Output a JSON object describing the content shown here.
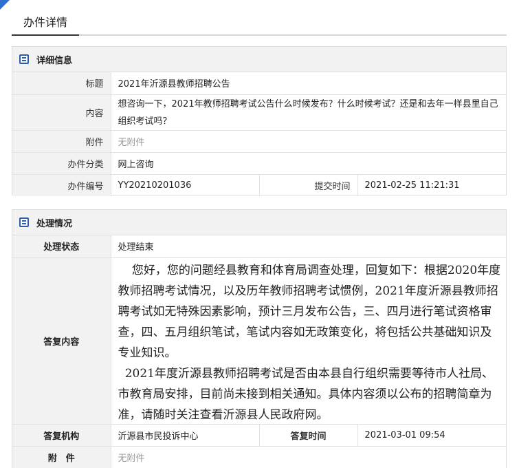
{
  "page": {
    "title": "办件详情"
  },
  "details": {
    "section_title": "详细信息",
    "title_label": "标题",
    "title_value": "2021年沂源县教师招聘公告",
    "content_label": "内容",
    "content_value": "想咨询一下，2021年教师招聘考试公告什么时候发布？什么时候考试？还是和去年一样县里自己组织考试吗？",
    "attachment_label": "附件",
    "attachment_value": "无附件",
    "category_label": "办件分类",
    "category_value": "网上咨询",
    "number_label": "办件编号",
    "number_value": "YY20210201036",
    "submit_time_label": "提交时间",
    "submit_time_value": "2021-02-25 11:21:31"
  },
  "handling": {
    "section_title": "处理情况",
    "status_label": "处理状态",
    "status_value": "处理结束",
    "reply_label": "答复内容",
    "reply_para_1": "您好，您的问题经县教育和体育局调查处理，回复如下：根据2020年度教师招聘考试情况，以及历年教师招聘考试惯例，2021年度沂源县教师招聘考试如无特殊因素影响，预计三月发布公告，三、四月进行笔试资格审查，四、五月组织笔试，笔试内容如无政策变化，将包括公共基础知识及专业知识。",
    "reply_para_2": "2021年度沂源县教师招聘考试是否由本县自行组织需要等待市人社局、市教育局安排，目前尚未接到相关通知。具体内容须以公布的招聘简章为准，请随时关注查看沂源县人民政府网。",
    "org_label": "答复机构",
    "org_value": "沂源县市民投诉中心",
    "reply_time_label": "答复时间",
    "reply_time_value": "2021-03-01 09:54",
    "attachment_label": "附　件",
    "attachment_value": "无附件"
  },
  "colors": {
    "accent": "#2a5db0",
    "label_bg": "#f2f2f2",
    "border": "#dcdcdc",
    "muted": "#999999"
  }
}
